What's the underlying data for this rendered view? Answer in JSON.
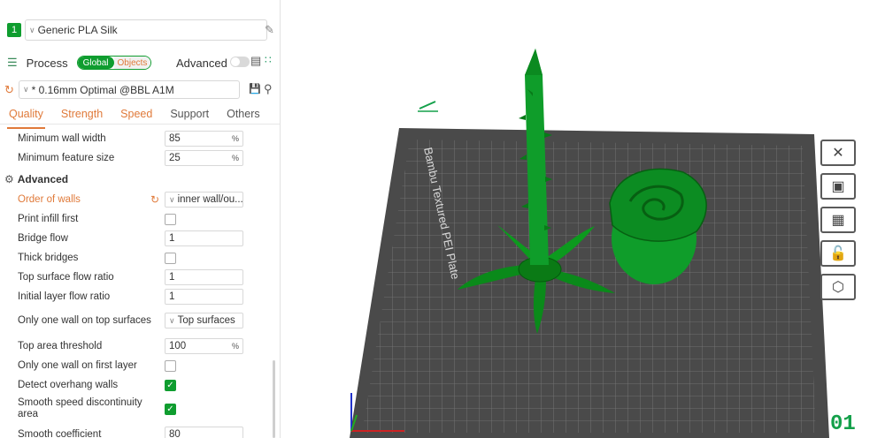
{
  "filament": {
    "index": "1",
    "name": "Generic PLA Silk"
  },
  "process": {
    "label": "Process",
    "toggle_global": "Global",
    "toggle_objects": "Objects",
    "advanced_label": "Advanced"
  },
  "preset": {
    "name": "* 0.16mm Optimal @BBL A1M"
  },
  "tabs": [
    "Quality",
    "Strength",
    "Speed",
    "Support",
    "Others"
  ],
  "params_top": [
    {
      "label": "Minimum wall width",
      "value": "85",
      "unit": "%"
    },
    {
      "label": "Minimum feature size",
      "value": "25",
      "unit": "%"
    }
  ],
  "group": {
    "title": "Advanced"
  },
  "params": [
    {
      "label": "Order of walls",
      "type": "select",
      "value": "inner wall/ou..."
    },
    {
      "label": "Print infill first",
      "type": "check",
      "value": false
    },
    {
      "label": "Bridge flow",
      "type": "input",
      "value": "1"
    },
    {
      "label": "Thick bridges",
      "type": "check",
      "value": false
    },
    {
      "label": "Top surface flow ratio",
      "type": "input",
      "value": "1"
    },
    {
      "label": "Initial layer flow ratio",
      "type": "input",
      "value": "1"
    },
    {
      "label": "Only one wall on top surfaces",
      "type": "select",
      "value": "Top surfaces"
    },
    {
      "label": "Top area threshold",
      "type": "input",
      "value": "100",
      "unit": "%"
    },
    {
      "label": "Only one wall on first layer",
      "type": "check",
      "value": false
    },
    {
      "label": "Detect overhang walls",
      "type": "check",
      "value": true
    },
    {
      "label": "Smooth speed discontinuity area",
      "type": "check",
      "value": true
    },
    {
      "label": "Smooth coefficient",
      "type": "input",
      "value": "80"
    }
  ],
  "viewport": {
    "plate_text": "Bambu Textured PEI Plate",
    "plate_number": "01",
    "accent": "#14a04a"
  },
  "icons": {
    "filament_edit": "edit-icon",
    "process": "layers-icon",
    "reset": "reset-icon",
    "save": "save-icon",
    "search": "search-icon",
    "list": "list-icon",
    "grid": "grid-icon"
  }
}
